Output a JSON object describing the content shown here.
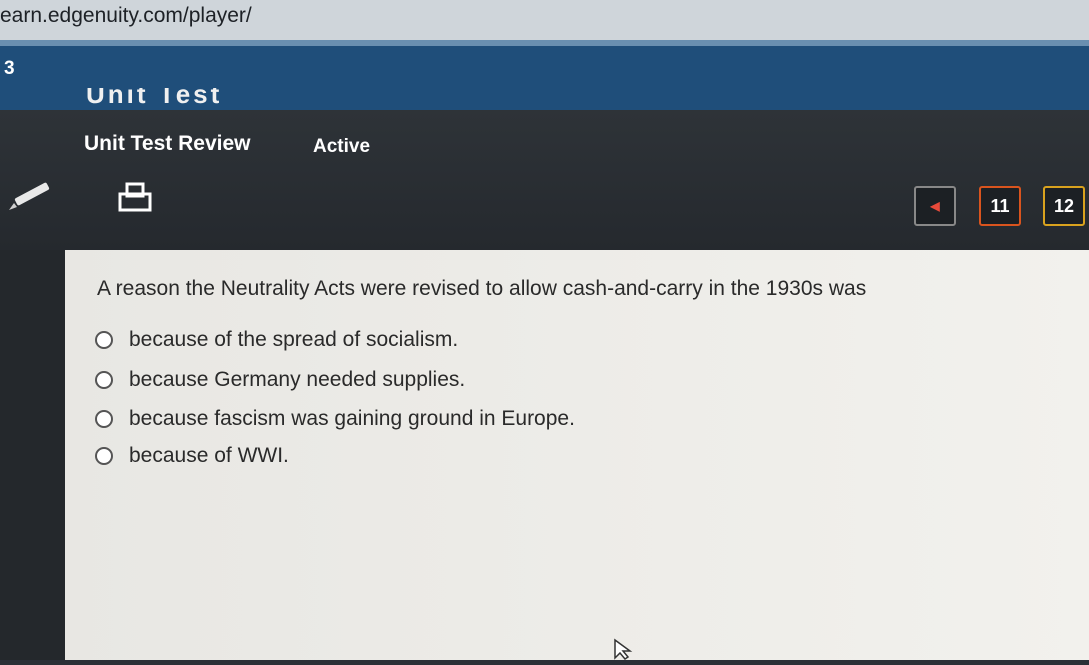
{
  "browser": {
    "url": "earn.edgenuity.com/player/"
  },
  "header": {
    "question_number": "3",
    "unit_title": "Unit Test"
  },
  "assessment": {
    "title": "Unit Test Review",
    "status": "Active"
  },
  "toolbar": {
    "pencil": "pencil-icon",
    "print": "printer-icon"
  },
  "pagination": {
    "prev_symbol": "◀",
    "pages": [
      "11",
      "12"
    ]
  },
  "question": {
    "text": "A reason the Neutrality Acts were revised to allow cash-and-carry in the 1930s was",
    "options": [
      "because of the spread of socialism.",
      "because Germany needed supplies.",
      "because fascism was gaining ground in Europe.",
      "because of WWI."
    ]
  }
}
